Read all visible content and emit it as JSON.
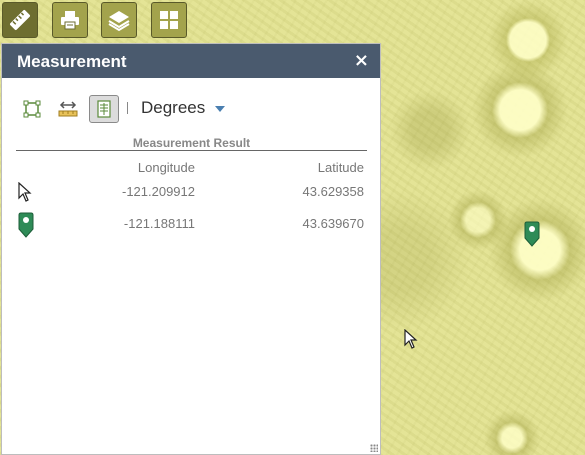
{
  "toolbar": {
    "tools": [
      {
        "name": "measurement-tool",
        "icon": "ruler-icon"
      },
      {
        "name": "print-tool",
        "icon": "printer-icon"
      },
      {
        "name": "layers-tool",
        "icon": "layers-icon"
      },
      {
        "name": "basemap-gallery-tool",
        "icon": "grid-icon"
      }
    ]
  },
  "panel": {
    "title": "Measurement",
    "close_label": "×",
    "modes": [
      {
        "name": "area",
        "icon": "area-icon"
      },
      {
        "name": "distance",
        "icon": "distance-icon"
      },
      {
        "name": "location",
        "icon": "location-icon",
        "selected": true
      }
    ],
    "unit": "Degrees",
    "result_title": "Measurement Result",
    "columns": {
      "longitude": "Longitude",
      "latitude": "Latitude"
    },
    "rows": [
      {
        "icon": "cursor-icon",
        "longitude": "-121.209912",
        "latitude": "43.629358"
      },
      {
        "icon": "map-pin-icon",
        "longitude": "-121.188111",
        "latitude": "43.639670"
      }
    ]
  },
  "colors": {
    "header": "#4a5a6e",
    "map": "#e2e293",
    "toolbar_button": "#a3a34c",
    "pin": "#2e8b57"
  }
}
